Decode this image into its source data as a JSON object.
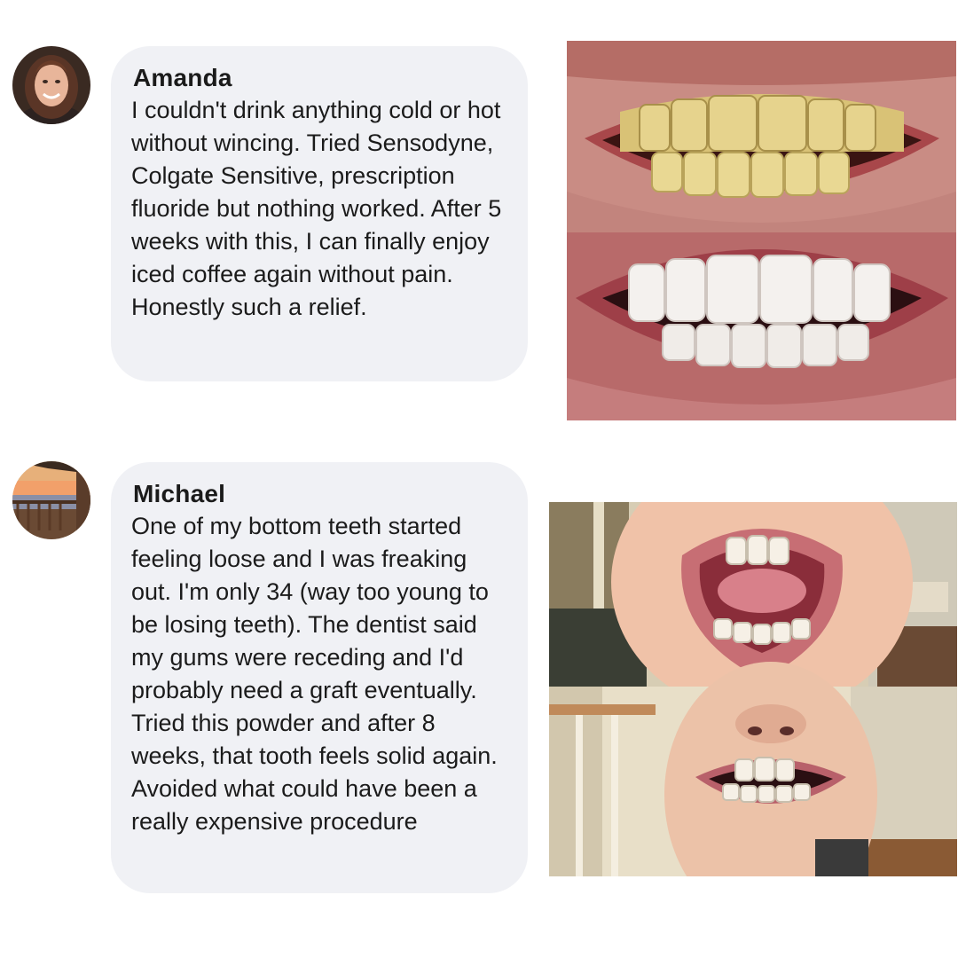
{
  "reviews": [
    {
      "name": "Amanda",
      "text": "I couldn't drink anything cold or hot without wincing. Tried Sensodyne, Colgate Sensitive, prescription fluoride but nothing worked. After 5 weeks with this, I can finally enjoy iced coffee again without pain. Honestly such a relief."
    },
    {
      "name": "Michael",
      "text": "One of my bottom teeth started feeling loose and I was freaking out. I'm only 34 (way too young to be losing teeth). The dentist said my gums were receding and I'd probably need a graft eventually. Tried this powder and after 8 weeks, that tooth feels solid again. Avoided what could have been a really expensive procedure"
    }
  ],
  "colors": {
    "bubble": "#f0f1f5",
    "text": "#1b1b1b"
  }
}
